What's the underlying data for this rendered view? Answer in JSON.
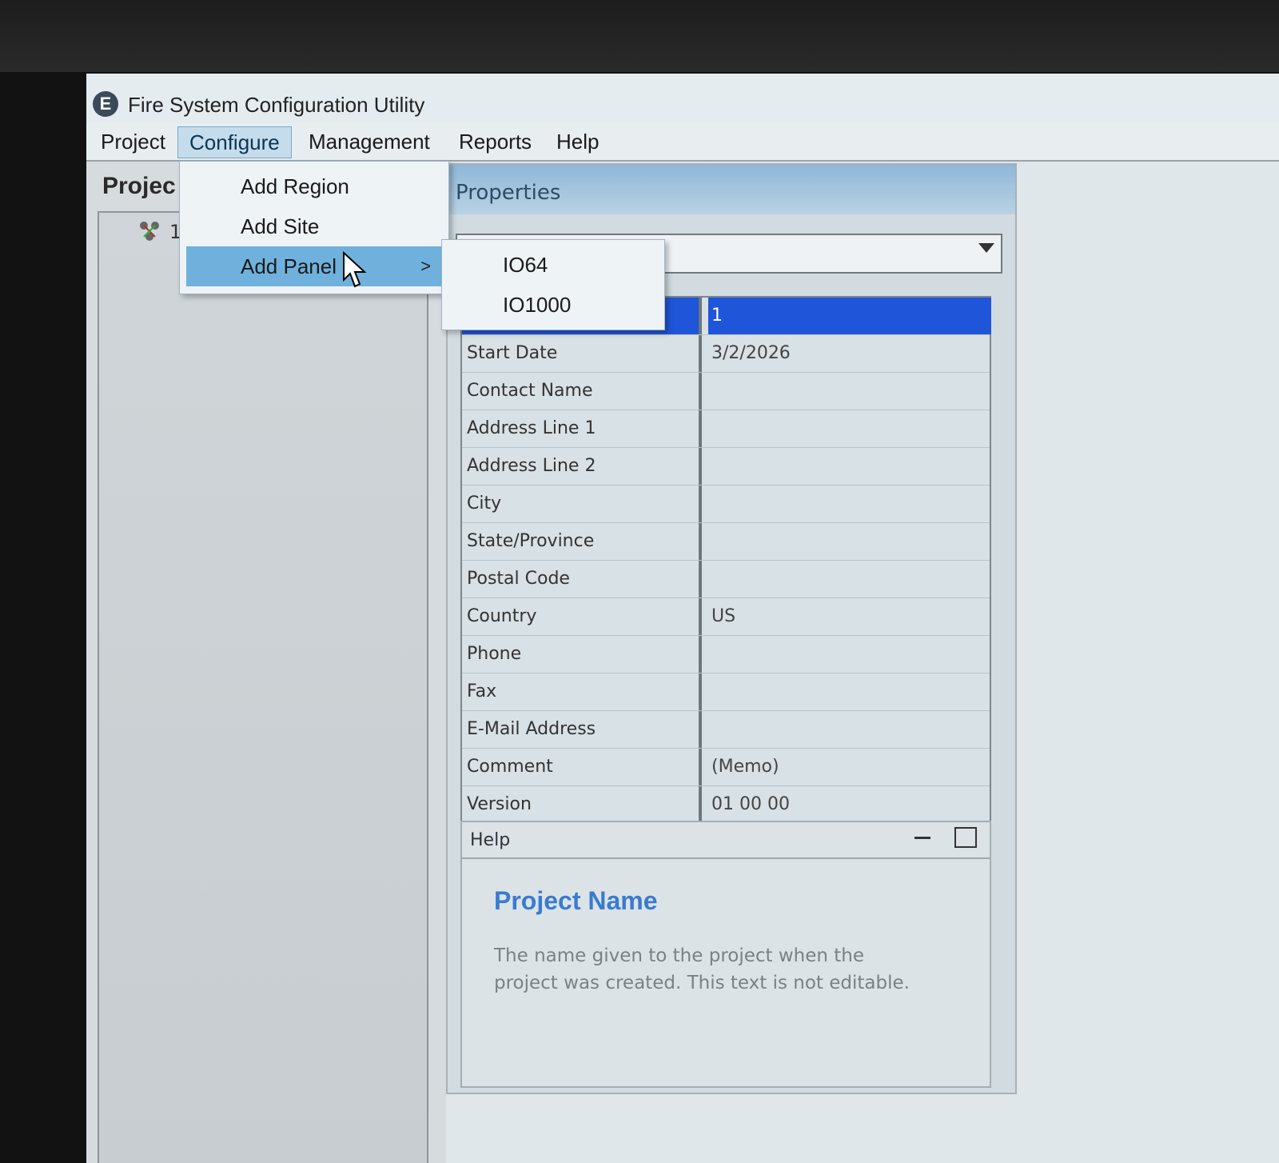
{
  "app": {
    "logo": "E",
    "title": "Fire System Configuration Utility"
  },
  "menubar": [
    "Project",
    "Configure",
    "Management",
    "Reports",
    "Help"
  ],
  "configure_menu": {
    "items": [
      "Add Region",
      "Add Site",
      "Add Panel"
    ],
    "submenu_arrow": ">",
    "add_panel_submenu": [
      "IO64",
      "IO1000"
    ]
  },
  "left_pane": {
    "heading": "Projec",
    "tree_node_label": "1"
  },
  "properties": {
    "title": "Properties",
    "rows": [
      {
        "name": "",
        "value": "1",
        "selected": true
      },
      {
        "name": "Start Date",
        "value": "3/2/2026"
      },
      {
        "name": "Contact Name",
        "value": ""
      },
      {
        "name": "Address Line 1",
        "value": ""
      },
      {
        "name": "Address Line 2",
        "value": ""
      },
      {
        "name": "City",
        "value": ""
      },
      {
        "name": "State/Province",
        "value": ""
      },
      {
        "name": "Postal Code",
        "value": ""
      },
      {
        "name": "Country",
        "value": "US"
      },
      {
        "name": "Phone",
        "value": ""
      },
      {
        "name": "Fax",
        "value": ""
      },
      {
        "name": "E-Mail Address",
        "value": ""
      },
      {
        "name": "Comment",
        "value": "(Memo)"
      },
      {
        "name": "Version",
        "value": "01 00 00"
      }
    ]
  },
  "help": {
    "title": "Help",
    "heading": "Project Name",
    "text": "The name given to the project when the project was created. This text is not editable."
  },
  "colors": {
    "selection": "#1f55d8",
    "menu_highlight": "#6fb1dc",
    "help_heading": "#3a7bd0"
  }
}
